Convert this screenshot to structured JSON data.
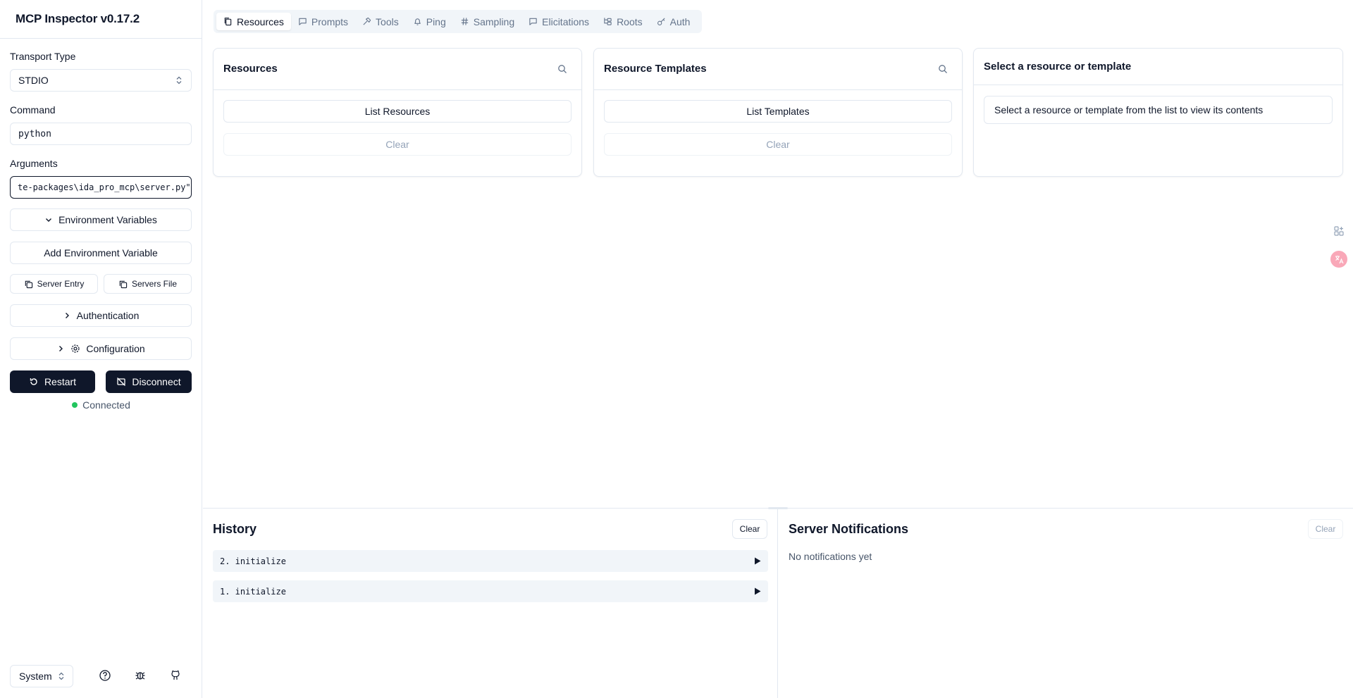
{
  "app": {
    "title": "MCP Inspector v0.17.2"
  },
  "sidebar": {
    "transport_label": "Transport Type",
    "transport_value": "STDIO",
    "command_label": "Command",
    "command_value": "python",
    "arguments_label": "Arguments",
    "arguments_value": "te-packages\\ida_pro_mcp\\server.py\"",
    "env_vars_label": "Environment Variables",
    "add_env_label": "Add Environment Variable",
    "server_entry_label": "Server Entry",
    "servers_file_label": "Servers File",
    "authentication_label": "Authentication",
    "configuration_label": "Configuration",
    "restart_label": "Restart",
    "disconnect_label": "Disconnect",
    "status_text": "Connected",
    "status_color": "#22c55e",
    "theme_value": "System"
  },
  "tabs": [
    {
      "label": "Resources",
      "icon": "files-icon",
      "active": true
    },
    {
      "label": "Prompts",
      "icon": "message-square-icon"
    },
    {
      "label": "Tools",
      "icon": "hammer-icon"
    },
    {
      "label": "Ping",
      "icon": "bell-icon"
    },
    {
      "label": "Sampling",
      "icon": "hash-icon"
    },
    {
      "label": "Elicitations",
      "icon": "message-square-icon"
    },
    {
      "label": "Roots",
      "icon": "folder-tree-icon"
    },
    {
      "label": "Auth",
      "icon": "key-icon"
    }
  ],
  "resources": {
    "title": "Resources",
    "list_button": "List Resources",
    "clear_button": "Clear"
  },
  "templates": {
    "title": "Resource Templates",
    "list_button": "List Templates",
    "clear_button": "Clear"
  },
  "viewer": {
    "title": "Select a resource or template",
    "message": "Select a resource or template from the list to view its contents"
  },
  "history": {
    "title": "History",
    "clear_button": "Clear",
    "items": [
      "2. initialize",
      "1. initialize"
    ]
  },
  "notifications": {
    "title": "Server Notifications",
    "clear_button": "Clear",
    "empty_text": "No notifications yet"
  },
  "colors": {
    "primary_dark": "#0f172a",
    "border": "#e2e8f0",
    "muted": "#64748b"
  }
}
